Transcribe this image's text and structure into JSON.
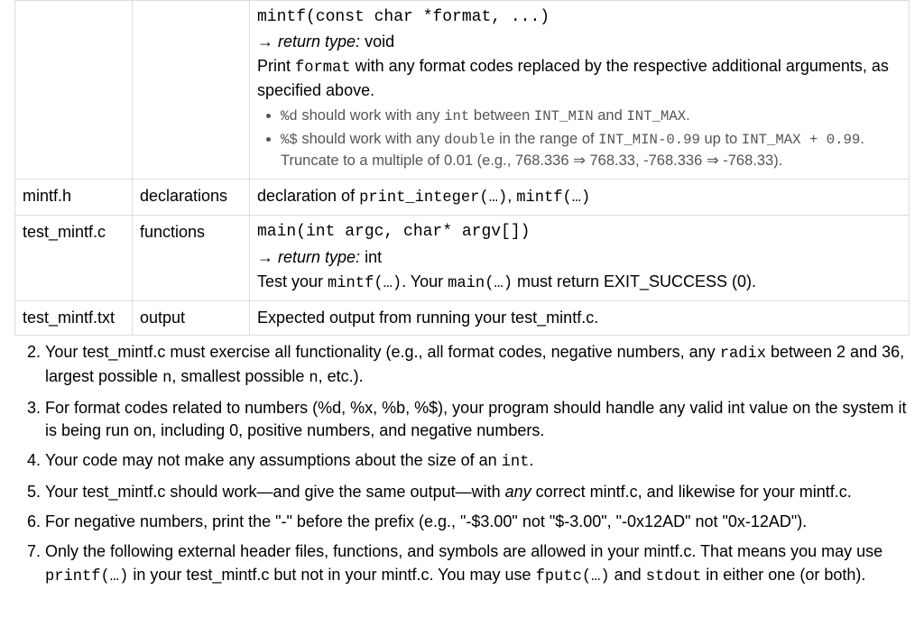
{
  "table": {
    "row0": {
      "sig": "mintf(const char *format, ...)",
      "arrow": "→",
      "rt_label": "return type:",
      "rt_value": " void",
      "desc_pre": "Print ",
      "desc_code": "format",
      "desc_post": " with any format codes replaced by the respective additional arguments, as specified above.",
      "bullet1_a": "%d",
      "bullet1_b": " should work with any ",
      "bullet1_c": "int",
      "bullet1_d": " between ",
      "bullet1_e": "INT_MIN",
      "bullet1_f": " and ",
      "bullet1_g": "INT_MAX",
      "bullet1_h": ".",
      "bullet2_a": "%$",
      "bullet2_b": " should work with any ",
      "bullet2_c": "double",
      "bullet2_d": " in the range of ",
      "bullet2_e": "INT_MIN-0.99",
      "bullet2_f": " up to ",
      "bullet2_g": "INT_MAX + 0.99",
      "bullet2_h": ". Truncate to a multiple of 0.01 (e.g., 768.336 ⇒ 768.33, -768.336 ⇒ -768.33)."
    },
    "row1": {
      "c1": "mintf.h",
      "c2": "declarations",
      "c3_pre": "declaration of ",
      "c3_code1": "print_integer(…)",
      "c3_mid": ", ",
      "c3_code2": "mintf(…)"
    },
    "row2": {
      "c1": "test_mintf.c",
      "c2": "functions",
      "sig": "main(int argc, char* argv[])",
      "arrow": "→",
      "rt_label": "return type:",
      "rt_value": " int",
      "desc_a": "Test your ",
      "desc_b": "mintf(…)",
      "desc_c": ". Your ",
      "desc_d": "main(…)",
      "desc_e": " must return EXIT_SUCCESS (0)."
    },
    "row3": {
      "c1": "test_mintf.txt",
      "c2": "output",
      "c3": "Expected output from running your test_mintf.c."
    }
  },
  "rules": {
    "r2_a": "Your test_mintf.c must exercise all functionality (e.g., all format codes, negative numbers, any ",
    "r2_b": "radix",
    "r2_c": " between 2 and 36, largest possible ",
    "r2_d": "n",
    "r2_e": ", smallest possible ",
    "r2_f": "n",
    "r2_g": ", etc.).",
    "r3": "For format codes related to numbers (%d, %x, %b, %$), your program should handle any valid int value on the system it is being run on, including 0, positive numbers, and negative numbers.",
    "r4_a": "Your code may not make any assumptions about the size of an ",
    "r4_b": "int",
    "r4_c": ".",
    "r5_a": "Your test_mintf.c should work—and give the same output—with ",
    "r5_b": "any",
    "r5_c": " correct mintf.c, and likewise for your mintf.c.",
    "r6": "For negative numbers, print the \"-\" before the prefix (e.g., \"-$3.00\" not \"$-3.00\", \"-0x12AD\" not \"0x-12AD\").",
    "r7_a": "Only the following external header files, functions, and symbols are allowed in your mintf.c. That means you may use ",
    "r7_b": "printf(…)",
    "r7_c": " in your test_mintf.c but not in your mintf.c. You may use ",
    "r7_d": "fputc(…)",
    "r7_e": " and ",
    "r7_f": "stdout",
    "r7_g": " in either one (or both)."
  }
}
